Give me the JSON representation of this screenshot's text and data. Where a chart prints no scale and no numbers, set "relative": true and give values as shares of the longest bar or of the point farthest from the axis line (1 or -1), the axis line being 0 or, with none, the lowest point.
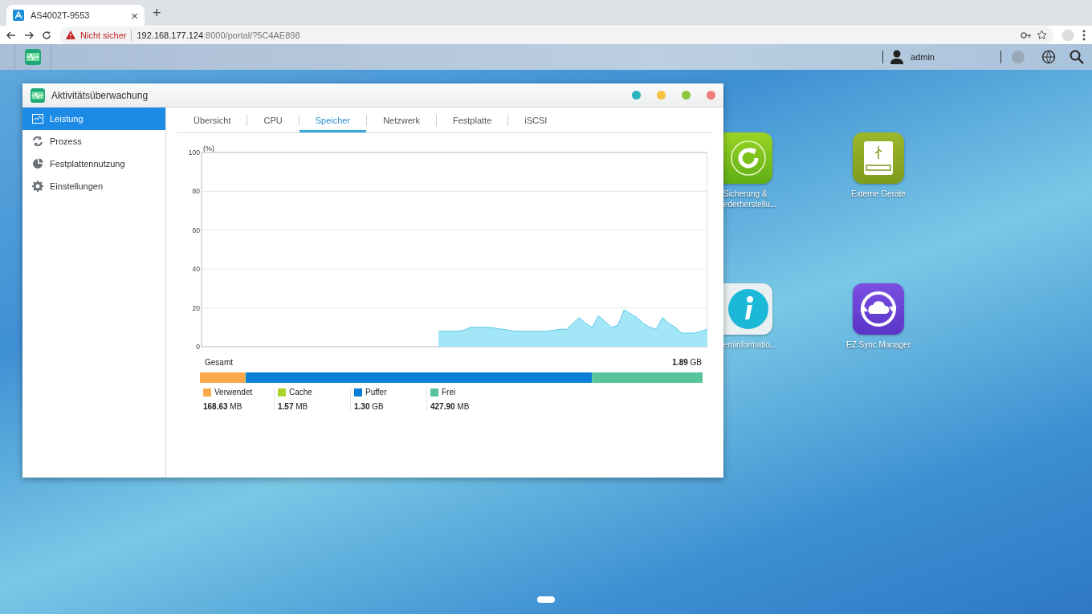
{
  "browser": {
    "tab": {
      "title": "AS4002T-9553",
      "close": "×",
      "selected": true
    },
    "new_tab": "+",
    "address": {
      "security": "Nicht sicher",
      "host": "192.168.177.124",
      "path": ":8000/portal/?5C4AE898"
    }
  },
  "taskbar": {
    "user": "admin"
  },
  "window": {
    "title": "Aktivitätsüberwachung"
  },
  "sidebar": {
    "items": [
      {
        "label": "Leistung",
        "kind": "chart",
        "selected": true
      },
      {
        "label": "Prozess",
        "kind": "refresh",
        "selected": false
      },
      {
        "label": "Festplattennutzung",
        "kind": "disk",
        "selected": false
      },
      {
        "label": "Einstellungen",
        "kind": "gear",
        "selected": false
      }
    ]
  },
  "tabs": [
    {
      "label": "Übersicht",
      "selected": false
    },
    {
      "label": "CPU",
      "selected": false
    },
    {
      "label": "Speicher",
      "selected": true
    },
    {
      "label": "Netzwerk",
      "selected": false
    },
    {
      "label": "Festplatte",
      "selected": false
    },
    {
      "label": "iSCSI",
      "selected": false
    }
  ],
  "chart": {
    "chart_data": {
      "type": "area",
      "grid": true,
      "ylabel": "(%)",
      "ylim": [
        0,
        100
      ],
      "yticks": [
        0,
        20,
        40,
        60,
        80,
        100
      ],
      "series": [
        {
          "color": "#a3e6f8",
          "values": [
            null,
            null,
            null,
            null,
            null,
            null,
            null,
            null,
            null,
            null,
            null,
            null,
            null,
            null,
            null,
            null,
            null,
            null,
            null,
            null,
            null,
            null,
            null,
            null,
            null,
            null,
            null,
            null,
            null,
            null,
            null,
            null,
            null,
            null,
            null,
            null,
            null,
            8,
            8,
            8,
            8,
            8.5,
            10,
            10,
            10,
            10,
            9.5,
            9,
            8.5,
            8,
            8,
            8,
            8,
            8,
            8,
            8.5,
            9,
            9,
            12,
            15,
            12,
            10,
            16,
            13,
            10,
            11,
            19,
            17,
            15,
            12,
            10,
            9,
            15,
            12,
            10,
            7,
            7,
            7,
            8,
            9
          ]
        }
      ]
    }
  },
  "memory": {
    "total_label": "Gesamt",
    "total": "**1.89** GB",
    "chart_data": {
      "type": "bar",
      "orientation": "horizontal",
      "stacked": true,
      "relative": true,
      "series": [
        {
          "name": "Verwendet",
          "color": "#f9a94b",
          "values": [
            0.09
          ]
        },
        {
          "name": "Cache",
          "color": "#a8d62b",
          "values": [
            0.001
          ]
        },
        {
          "name": "Puffer",
          "color": "#0a7fd8",
          "values": [
            0.689
          ]
        },
        {
          "name": "Frei",
          "color": "#58c49a",
          "values": [
            0.22
          ]
        }
      ]
    },
    "readings": [
      "**168.63** MB",
      "**1.57** MB",
      "**1.30** GB",
      "**427.90** MB"
    ]
  },
  "desktop_icons": [
    {
      "kind": "backup",
      "lines": [
        "Sicherung &",
        "ederherstellu..."
      ]
    },
    {
      "kind": "external",
      "lines": [
        "Externe Geräte"
      ]
    },
    {
      "kind": "info",
      "lines": [
        "eminformatio..."
      ]
    },
    {
      "kind": "sync",
      "lines": [
        "EZ Sync Manager"
      ]
    }
  ]
}
